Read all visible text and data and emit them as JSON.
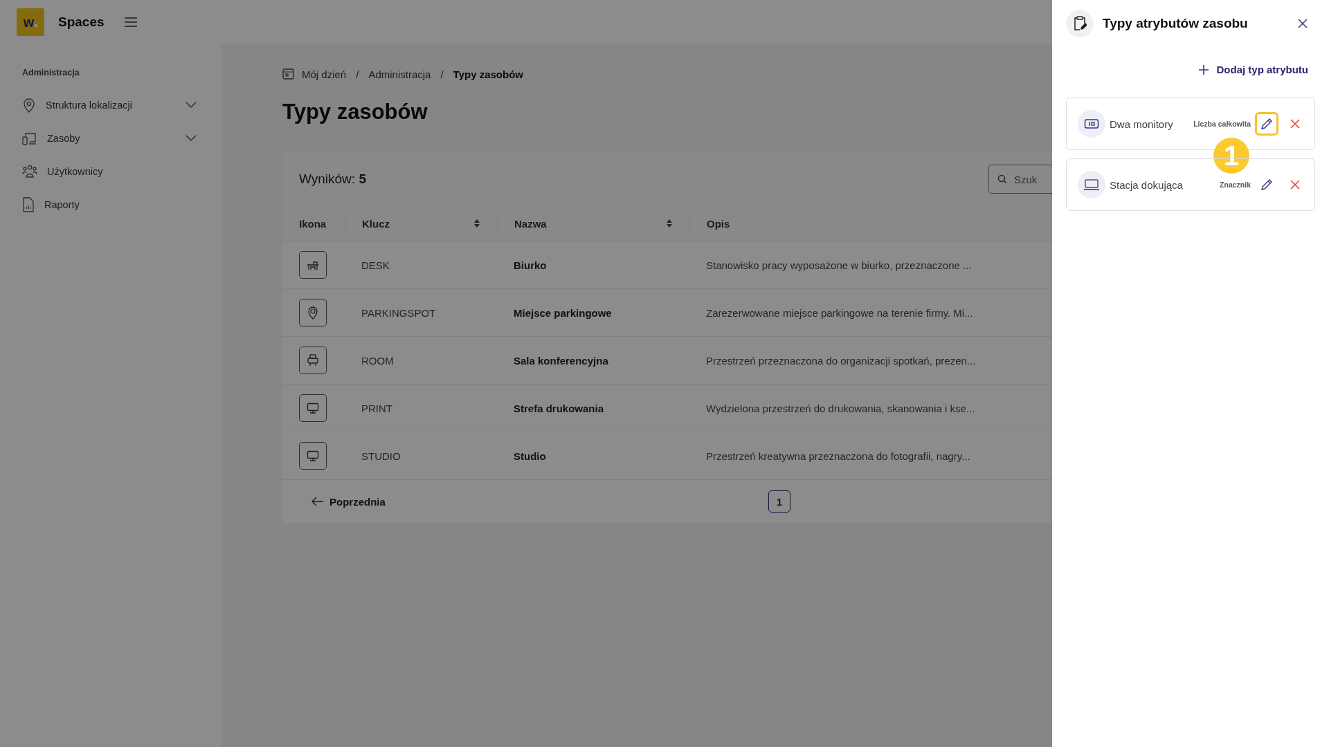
{
  "app": {
    "logo": "w",
    "name": "Spaces"
  },
  "sidebar": {
    "section": "Administracja",
    "items": [
      {
        "label": "Struktura lokalizacji",
        "expandable": true
      },
      {
        "label": "Zasoby",
        "expandable": true
      },
      {
        "label": "Użytkownicy",
        "expandable": false
      },
      {
        "label": "Raporty",
        "expandable": false
      }
    ]
  },
  "breadcrumb": [
    {
      "kind": "link",
      "text": "Mój dzień"
    },
    {
      "kind": "separator",
      "text": "/"
    },
    {
      "kind": "link",
      "text": "Administracja"
    },
    {
      "kind": "separator",
      "text": "/"
    },
    {
      "kind": "current",
      "text": "Typy zasobów"
    }
  ],
  "page_title": "Typy zasobów",
  "results": {
    "label": "Wyników:",
    "count": "5"
  },
  "search": {
    "placeholder": "Szuk"
  },
  "table": {
    "columns": [
      {
        "label": "Ikona",
        "sortable": false
      },
      {
        "label": "Klucz",
        "sortable": true
      },
      {
        "label": "Nazwa",
        "sortable": true
      },
      {
        "label": "Opis",
        "sortable": false
      }
    ],
    "rows": [
      {
        "key": "DESK",
        "name": "Biurko",
        "description": "Stanowisko pracy wyposażone w biurko, przeznaczone ..."
      },
      {
        "key": "PARKINGSPOT",
        "name": "Miejsce parkingowe",
        "description": "Zarezerwowane miejsce parkingowe na terenie firmy. Mi..."
      },
      {
        "key": "ROOM",
        "name": "Sala konferencyjna",
        "description": "Przestrzeń przeznaczona do organizacji spotkań, prezen..."
      },
      {
        "key": "PRINT",
        "name": "Strefa drukowania",
        "description": "Wydzielona przestrzeń do drukowania, skanowania i kse..."
      },
      {
        "key": "STUDIO",
        "name": "Studio",
        "description": "Przestrzeń kreatywna przeznaczona do fotografii, nagry..."
      }
    ]
  },
  "pagination": {
    "previous": "Poprzednia",
    "pages": [
      {
        "label": "1",
        "selected": true
      }
    ]
  },
  "panel": {
    "title": "Typy atrybutów zasobu",
    "add_button": "Dodaj typ atrybutu",
    "attributes": [
      {
        "name": "Dwa monitory",
        "type": "Liczba całkowita",
        "highlighted": true,
        "step_badge": "1"
      },
      {
        "name": "Stacja dokująca",
        "type": "Znacznik",
        "highlighted": false
      }
    ]
  }
}
